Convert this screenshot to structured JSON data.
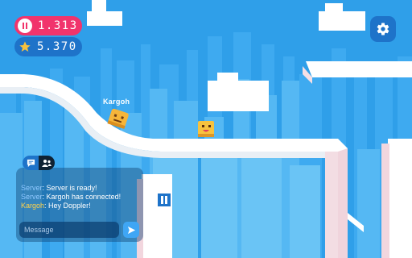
{
  "hud": {
    "timer": "1.313",
    "score": "5.370",
    "pause_icon": "pause-icon",
    "score_icon": "star-icon",
    "settings_icon": "gear-icon"
  },
  "player": {
    "name": "Kargoh"
  },
  "chat": {
    "tabs": [
      {
        "icon": "chat-bubble-icon",
        "active": true
      },
      {
        "icon": "players-icon",
        "active": false
      }
    ],
    "messages": [
      {
        "sender": "Server",
        "text": "Server is ready!"
      },
      {
        "sender": "Server",
        "text": "Kargoh has connected!"
      },
      {
        "sender": "Kargoh",
        "text": "Hey Doppler!"
      }
    ],
    "input_placeholder": "Message",
    "send_icon": "send-arrow-icon"
  },
  "colors": {
    "sky": "#2f9fe9",
    "timer_pill": "#f1346c",
    "hud_pill": "#1e73c9",
    "track": "#ffffff",
    "player_cube": "#f5b53a",
    "player_cube_2": "#f7c23e"
  }
}
